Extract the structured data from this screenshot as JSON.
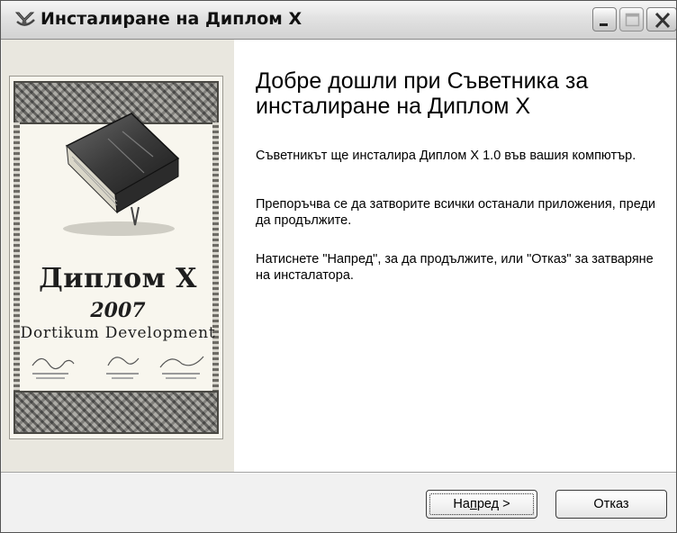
{
  "window": {
    "title": "Инсталиране на Диплом X",
    "icon": "installer-icon"
  },
  "title_buttons": {
    "minimize": "minimize-icon",
    "maximize": "maximize-icon",
    "close": "close-icon"
  },
  "banner": {
    "product": "Диплом X",
    "year": "2007",
    "company": "Dortikum Development"
  },
  "content": {
    "heading": "Добре дошли при Съветника за инсталиране на Диплом X",
    "paragraph1": "Съветникът ще инсталира Диплом X 1.0 във вашия компютър.",
    "paragraph2": "Препоръчва се да затворите всички останали приложения, преди да продължите.",
    "paragraph3": "Натиснете \"Напред\", за да продължите, или \"Отказ\" за затваряне на инсталатора."
  },
  "buttons": {
    "next_prefix": "На",
    "next_mnemonic": "п",
    "next_suffix": "ред >",
    "cancel": "Отказ"
  }
}
